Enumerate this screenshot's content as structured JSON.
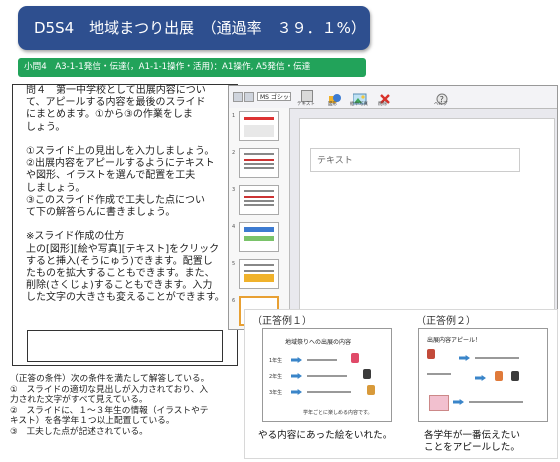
{
  "header": {
    "title": "D5S4　地域まつり出展　（通過率　３９．１%）",
    "subtitle": "小問4　A3-1-1発信・伝達(，A1-1-1操作・活用)：A1操作, A5発信・伝達"
  },
  "question": {
    "text": "問４　第一中学校として出展内容につい\nて、アピールする内容を最後のスライド\nにまとめます。①から③の作業をしま\nしょう。\n\n①スライド上の見出しを入力しましょう。\n②出展内容をアピールするようにテキスト\nや図形、イラストを選んで配置を工夫\nしましょう。\n③このスライド作成で工夫した点につい\nて下の解答らんに書きましょう。\n\n※スライド作成の仕方\n上の[図形][絵や写真][テキスト]をクリック\nすると挿入(そうにゅう)できます。配置し\nたものを拡大することもできます。また、\n削除(さくじょ)することもできます。入力\nした文字の大きさも変えることができます。"
  },
  "app": {
    "font_field": "MS ゴシック",
    "ribbon_labels": [
      "テキスト",
      "図形",
      "絵や写真",
      "削除",
      "ヘルプ"
    ],
    "thumb_numbers": [
      "1",
      "2",
      "3",
      "4",
      "5",
      "6"
    ],
    "title_placeholder": "テキスト"
  },
  "conditions": {
    "text": "（正答の条件）次の条件を満たして解答している。\n①　スライドの適切な見出しが入力されており、入\n力された文字がすべて見えている。\n②　スライドに、１～３年生の情報（イラストやテ\nキスト）を各学年１つ以上配置している。\n③　工夫した点が記述されている。"
  },
  "examples": {
    "ex1": {
      "label": "（正答例１）",
      "slide_title": "地域祭りへの出展の内容",
      "rows": [
        "1年生",
        "2年生",
        "3年生"
      ],
      "footer": "学年ごとに楽しめる内容です。",
      "caption": "やる内容にあった絵をいれた。"
    },
    "ex2": {
      "label": "（正答例２）",
      "slide_title": "出展内容アピール！",
      "caption": "各学年が一番伝えたい\nことをアピールした。"
    }
  },
  "colors": {
    "banner": "#2e4f8f",
    "tagbar": "#22a35a",
    "arrow": "#3a85c9"
  }
}
